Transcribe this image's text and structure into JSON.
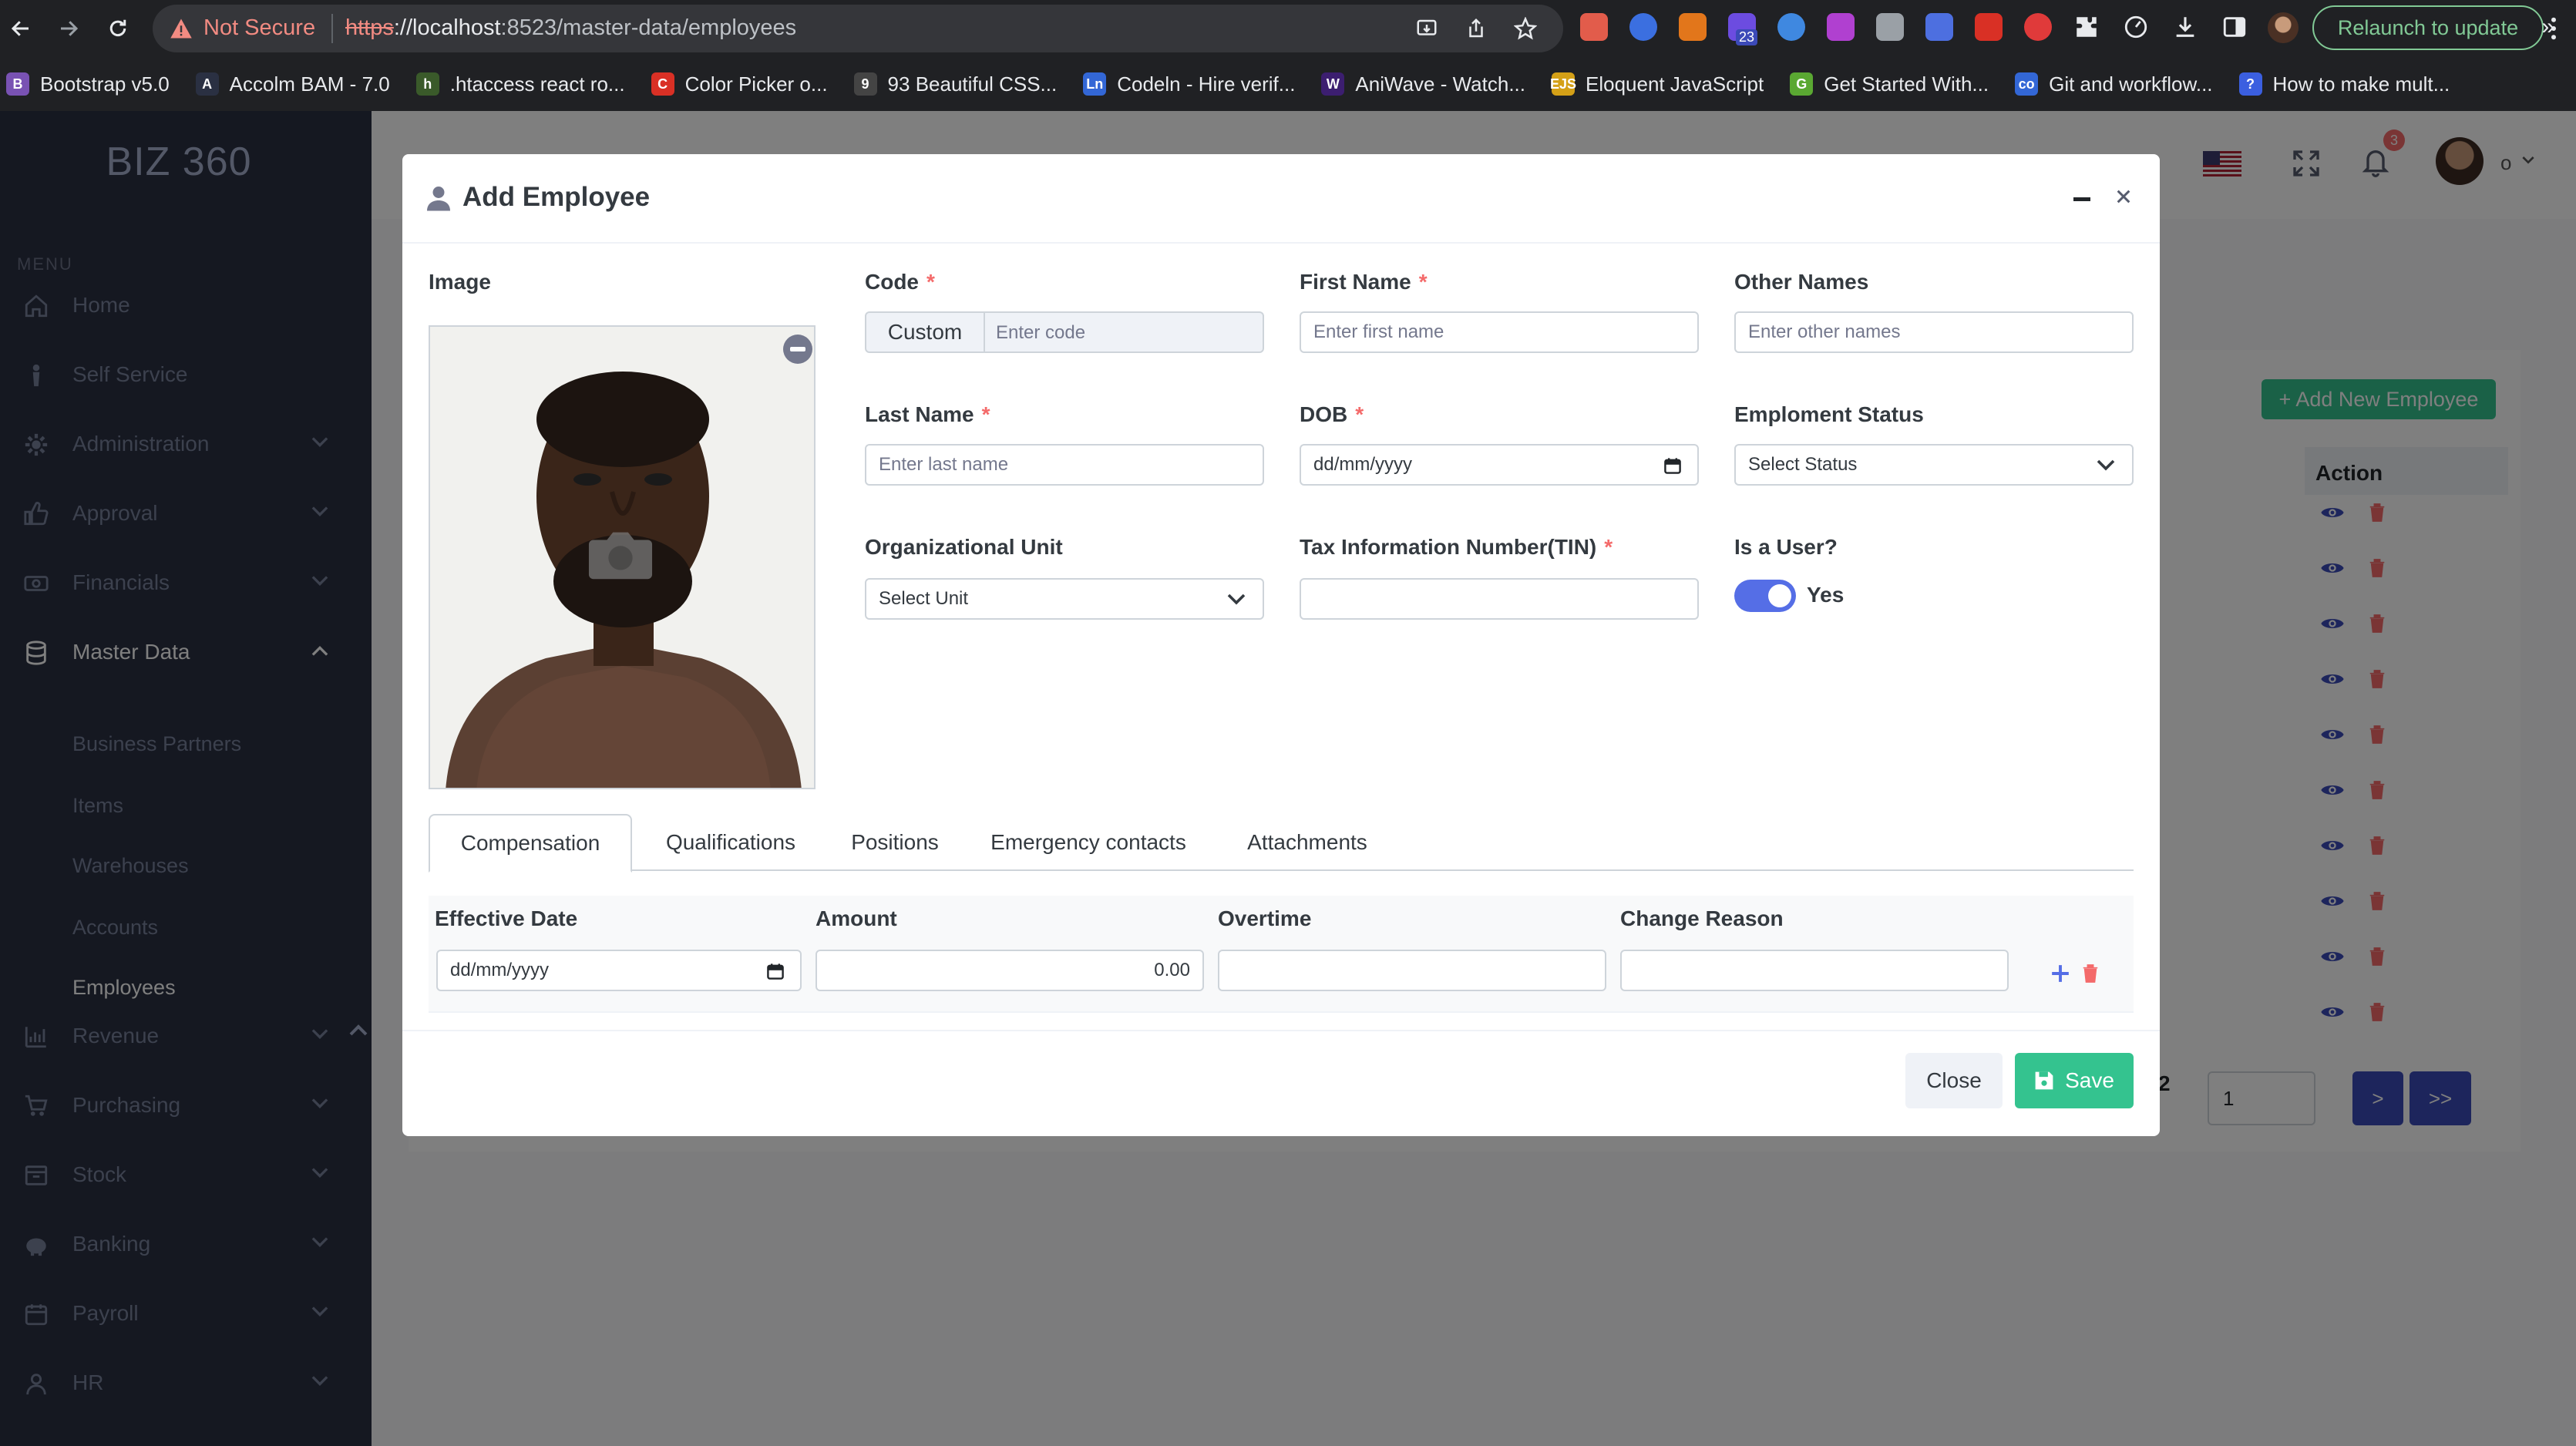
{
  "browser": {
    "not_secure": "Not Secure",
    "url_scheme": "https",
    "url_host": "://localhost",
    "url_rest": ":8523/master-data/employees",
    "relaunch": "Relaunch to update",
    "ext_badge": "23",
    "bookmarks": [
      {
        "label": "Bootstrap v5.0",
        "icon": "B",
        "color": "#7952b3"
      },
      {
        "label": "Accolm BAM - 7.0",
        "icon": "A",
        "color": "#2a3042"
      },
      {
        "label": ".htaccess react ro...",
        "icon": "h",
        "color": "#3a5a2a"
      },
      {
        "label": "Color Picker o...",
        "icon": "C",
        "color": "#d93025"
      },
      {
        "label": "93 Beautiful CSS...",
        "icon": "9",
        "color": "#444"
      },
      {
        "label": "Codeln - Hire verif...",
        "icon": "Ln",
        "color": "#3367d6"
      },
      {
        "label": "AniWave - Watch...",
        "icon": "W",
        "color": "#3c1e70"
      },
      {
        "label": "Eloquent JavaScript",
        "icon": "EJS",
        "color": "#d4a017"
      },
      {
        "label": "Get Started With...",
        "icon": "G",
        "color": "#5aa832"
      },
      {
        "label": "Git and workflow...",
        "icon": "co",
        "color": "#3367d6"
      },
      {
        "label": "How to make mult...",
        "icon": "?",
        "color": "#3b5fe0"
      }
    ],
    "bookmarks_more": "»"
  },
  "sidebar": {
    "brand": "BIZ 360",
    "menu_title": "MENU",
    "items": [
      {
        "label": "Home",
        "icon": "home-icon",
        "chevron": false
      },
      {
        "label": "Self Service",
        "icon": "person-icon",
        "chevron": false
      },
      {
        "label": "Administration",
        "icon": "gear-icon",
        "chevron": true
      },
      {
        "label": "Approval",
        "icon": "thumbs-up-icon",
        "chevron": true
      },
      {
        "label": "Financials",
        "icon": "money-icon",
        "chevron": true
      },
      {
        "label": "Master Data",
        "icon": "database-icon",
        "chevron": true,
        "expanded": true
      },
      {
        "label": "Revenue",
        "icon": "chart-icon",
        "chevron": true
      },
      {
        "label": "Purchasing",
        "icon": "cart-icon",
        "chevron": true
      },
      {
        "label": "Stock",
        "icon": "box-icon",
        "chevron": true
      },
      {
        "label": "Banking",
        "icon": "piggy-bank-icon",
        "chevron": true
      },
      {
        "label": "Payroll",
        "icon": "calendar-icon",
        "chevron": true
      },
      {
        "label": "HR",
        "icon": "user-icon",
        "chevron": true
      }
    ],
    "sub_items": [
      "Business Partners",
      "Items",
      "Warehouses",
      "Accounts",
      "Employees"
    ],
    "active_sub": "Employees"
  },
  "background_page": {
    "add_new": "+ Add New Employee",
    "action_header": "Action",
    "page_number_label": "2",
    "page_input": "1",
    "next": ">",
    "last": ">>",
    "notification_count": "3",
    "user_initial": "o"
  },
  "modal": {
    "title": "Add Employee",
    "image_label": "Image",
    "fields": {
      "code": {
        "label": "Code",
        "prefix": "Custom",
        "placeholder": "Enter code",
        "required": true
      },
      "first_name": {
        "label": "First Name",
        "placeholder": "Enter first name",
        "required": true
      },
      "other_names": {
        "label": "Other Names",
        "placeholder": "Enter other names",
        "required": false
      },
      "last_name": {
        "label": "Last Name",
        "placeholder": "Enter last name",
        "required": true
      },
      "dob": {
        "label": "DOB",
        "value": "dd/mm/yyyy",
        "required": true
      },
      "employment_status": {
        "label": "Emploment Status",
        "value": "Select Status",
        "required": false
      },
      "org_unit": {
        "label": "Organizational Unit",
        "value": "Select Unit",
        "required": false
      },
      "tin": {
        "label": "Tax Information Number(TIN)",
        "value": "",
        "required": true
      },
      "is_user": {
        "label": "Is a User?",
        "value": "Yes",
        "enabled": true
      }
    },
    "required_mark": "*",
    "tabs": [
      "Compensation",
      "Qualifications",
      "Positions",
      "Emergency contacts",
      "Attachments"
    ],
    "active_tab": "Compensation",
    "compensation": {
      "columns": [
        "Effective Date",
        "Amount",
        "Overtime",
        "Change Reason"
      ],
      "row": {
        "effective_date": "dd/mm/yyyy",
        "amount": "0.00",
        "overtime": "",
        "change_reason": ""
      }
    },
    "buttons": {
      "close": "Close",
      "save": "Save"
    }
  },
  "colors": {
    "primary": "#556ee6",
    "success": "#34c38f",
    "danger": "#f46a6a",
    "sidebar": "#2a3042"
  }
}
